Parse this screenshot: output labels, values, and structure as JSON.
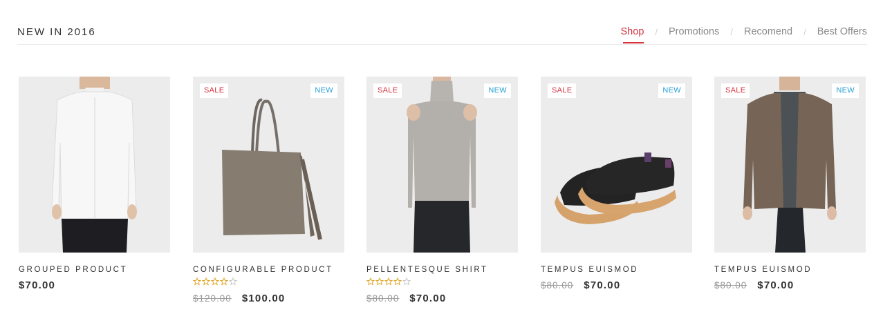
{
  "section": {
    "title": "NEW IN 2016"
  },
  "tabs": [
    {
      "label": "Shop",
      "active": true
    },
    {
      "label": "Promotions",
      "active": false
    },
    {
      "label": "Recomend",
      "active": false
    },
    {
      "label": "Best Offers",
      "active": false
    }
  ],
  "tab_separator": "/",
  "accent_color": "#d6323f",
  "new_badge_color": "#2a9fd6",
  "star_color": "#e0a526",
  "products": [
    {
      "name": "GROUPED PRODUCT",
      "price": "$70.00",
      "old_price": "",
      "sale": false,
      "new": false,
      "rating": null,
      "image": "men-white-shirt"
    },
    {
      "name": "CONFIGURABLE PRODUCT",
      "price": "$100.00",
      "old_price": "$120.00",
      "sale": true,
      "new": true,
      "sale_label": "SALE",
      "new_label": "NEW",
      "rating": 4,
      "rating_max": 5,
      "image": "suede-tote-bag"
    },
    {
      "name": "PELLENTESQUE SHIRT",
      "price": "$70.00",
      "old_price": "$80.00",
      "sale": true,
      "new": true,
      "sale_label": "SALE",
      "new_label": "NEW",
      "rating": 4,
      "rating_max": 5,
      "image": "cold-shoulder-knit-top"
    },
    {
      "name": "TEMPUS EUISMOD",
      "price": "$70.00",
      "old_price": "$80.00",
      "sale": true,
      "new": true,
      "sale_label": "SALE",
      "new_label": "NEW",
      "rating": null,
      "image": "black-sneakers"
    },
    {
      "name": "TEMPUS EUISMOD",
      "price": "$70.00",
      "old_price": "$80.00",
      "sale": true,
      "new": true,
      "sale_label": "SALE",
      "new_label": "NEW",
      "rating": null,
      "image": "brown-shirt-jacket"
    }
  ]
}
